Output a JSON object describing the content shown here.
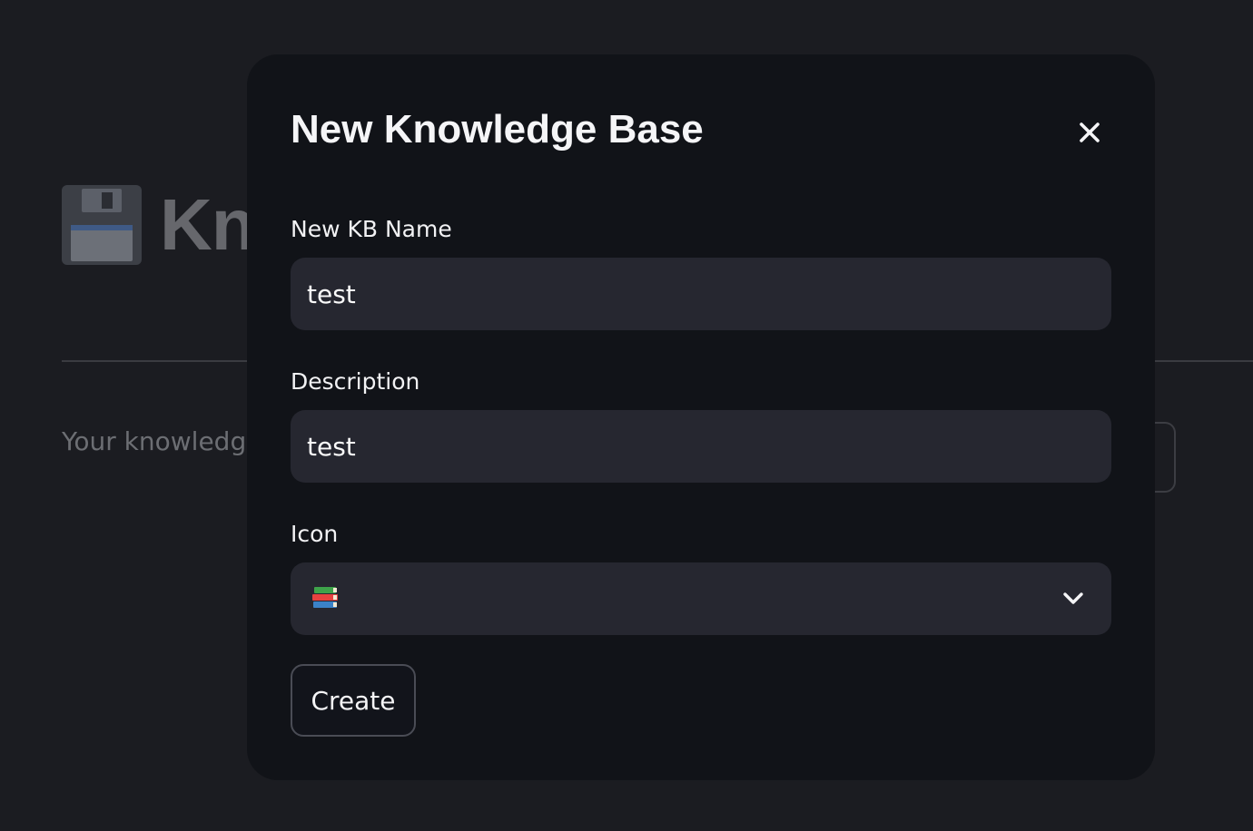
{
  "background": {
    "title": "Kn",
    "title_icon": "floppy-disk-icon",
    "subtitle": "Your knowledge"
  },
  "modal": {
    "title": "New Knowledge Base",
    "close_icon": "close-icon",
    "fields": {
      "name": {
        "label": "New KB Name",
        "value": "test"
      },
      "description": {
        "label": "Description",
        "value": "test"
      },
      "icon": {
        "label": "Icon",
        "selected_icon": "books-icon"
      }
    },
    "create_label": "Create"
  },
  "colors": {
    "page_background": "#1b1c21",
    "modal_background": "#111318",
    "input_background": "#262730",
    "text": "#f5f5f7"
  }
}
